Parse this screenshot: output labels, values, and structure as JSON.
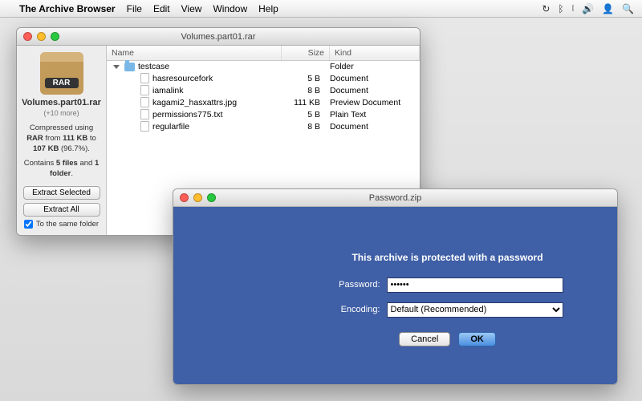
{
  "menubar": {
    "app_name": "The Archive Browser",
    "items": [
      "File",
      "Edit",
      "View",
      "Window",
      "Help"
    ]
  },
  "archive_window": {
    "title": "Volumes.part01.rar",
    "sidebar": {
      "icon_label": "RAR",
      "filename": "Volumes.part01.rar",
      "more": "(+10 more)",
      "info1_pre": "Compressed using ",
      "info1_bold1": "RAR",
      "info1_mid": " from ",
      "info1_bold2": "111 KB",
      "info1_to": " to ",
      "info1_bold3": "107 KB",
      "info1_pct": " (96.7%).",
      "info2_pre": "Contains ",
      "info2_bold1": "5 files",
      "info2_and": " and ",
      "info2_bold2": "1 folder",
      "info2_end": ".",
      "btn_extract_selected": "Extract Selected",
      "btn_extract_all": "Extract All",
      "checkbox_label": "To the same folder",
      "checkbox_checked": true
    },
    "columns": {
      "name": "Name",
      "size": "Size",
      "kind": "Kind"
    },
    "rows": [
      {
        "depth": 0,
        "type": "folder",
        "name": "testcase",
        "size": "",
        "kind": "Folder",
        "expanded": true
      },
      {
        "depth": 1,
        "type": "doc",
        "name": "hasresourcefork",
        "size": "5 B",
        "kind": "Document"
      },
      {
        "depth": 1,
        "type": "doc",
        "name": "iamalink",
        "size": "8 B",
        "kind": "Document"
      },
      {
        "depth": 1,
        "type": "doc",
        "name": "kagami2_hasxattrs.jpg",
        "size": "111 KB",
        "kind": "Preview Document"
      },
      {
        "depth": 1,
        "type": "doc",
        "name": "permissions775.txt",
        "size": "5 B",
        "kind": "Plain Text"
      },
      {
        "depth": 1,
        "type": "doc",
        "name": "regularfile",
        "size": "8 B",
        "kind": "Document"
      }
    ]
  },
  "password_window": {
    "title": "Password.zip",
    "heading": "This archive is protected with a password",
    "password_label": "Password:",
    "password_value": "••••••",
    "encoding_label": "Encoding:",
    "encoding_value": "Default (Recommended)",
    "cancel": "Cancel",
    "ok": "OK"
  }
}
